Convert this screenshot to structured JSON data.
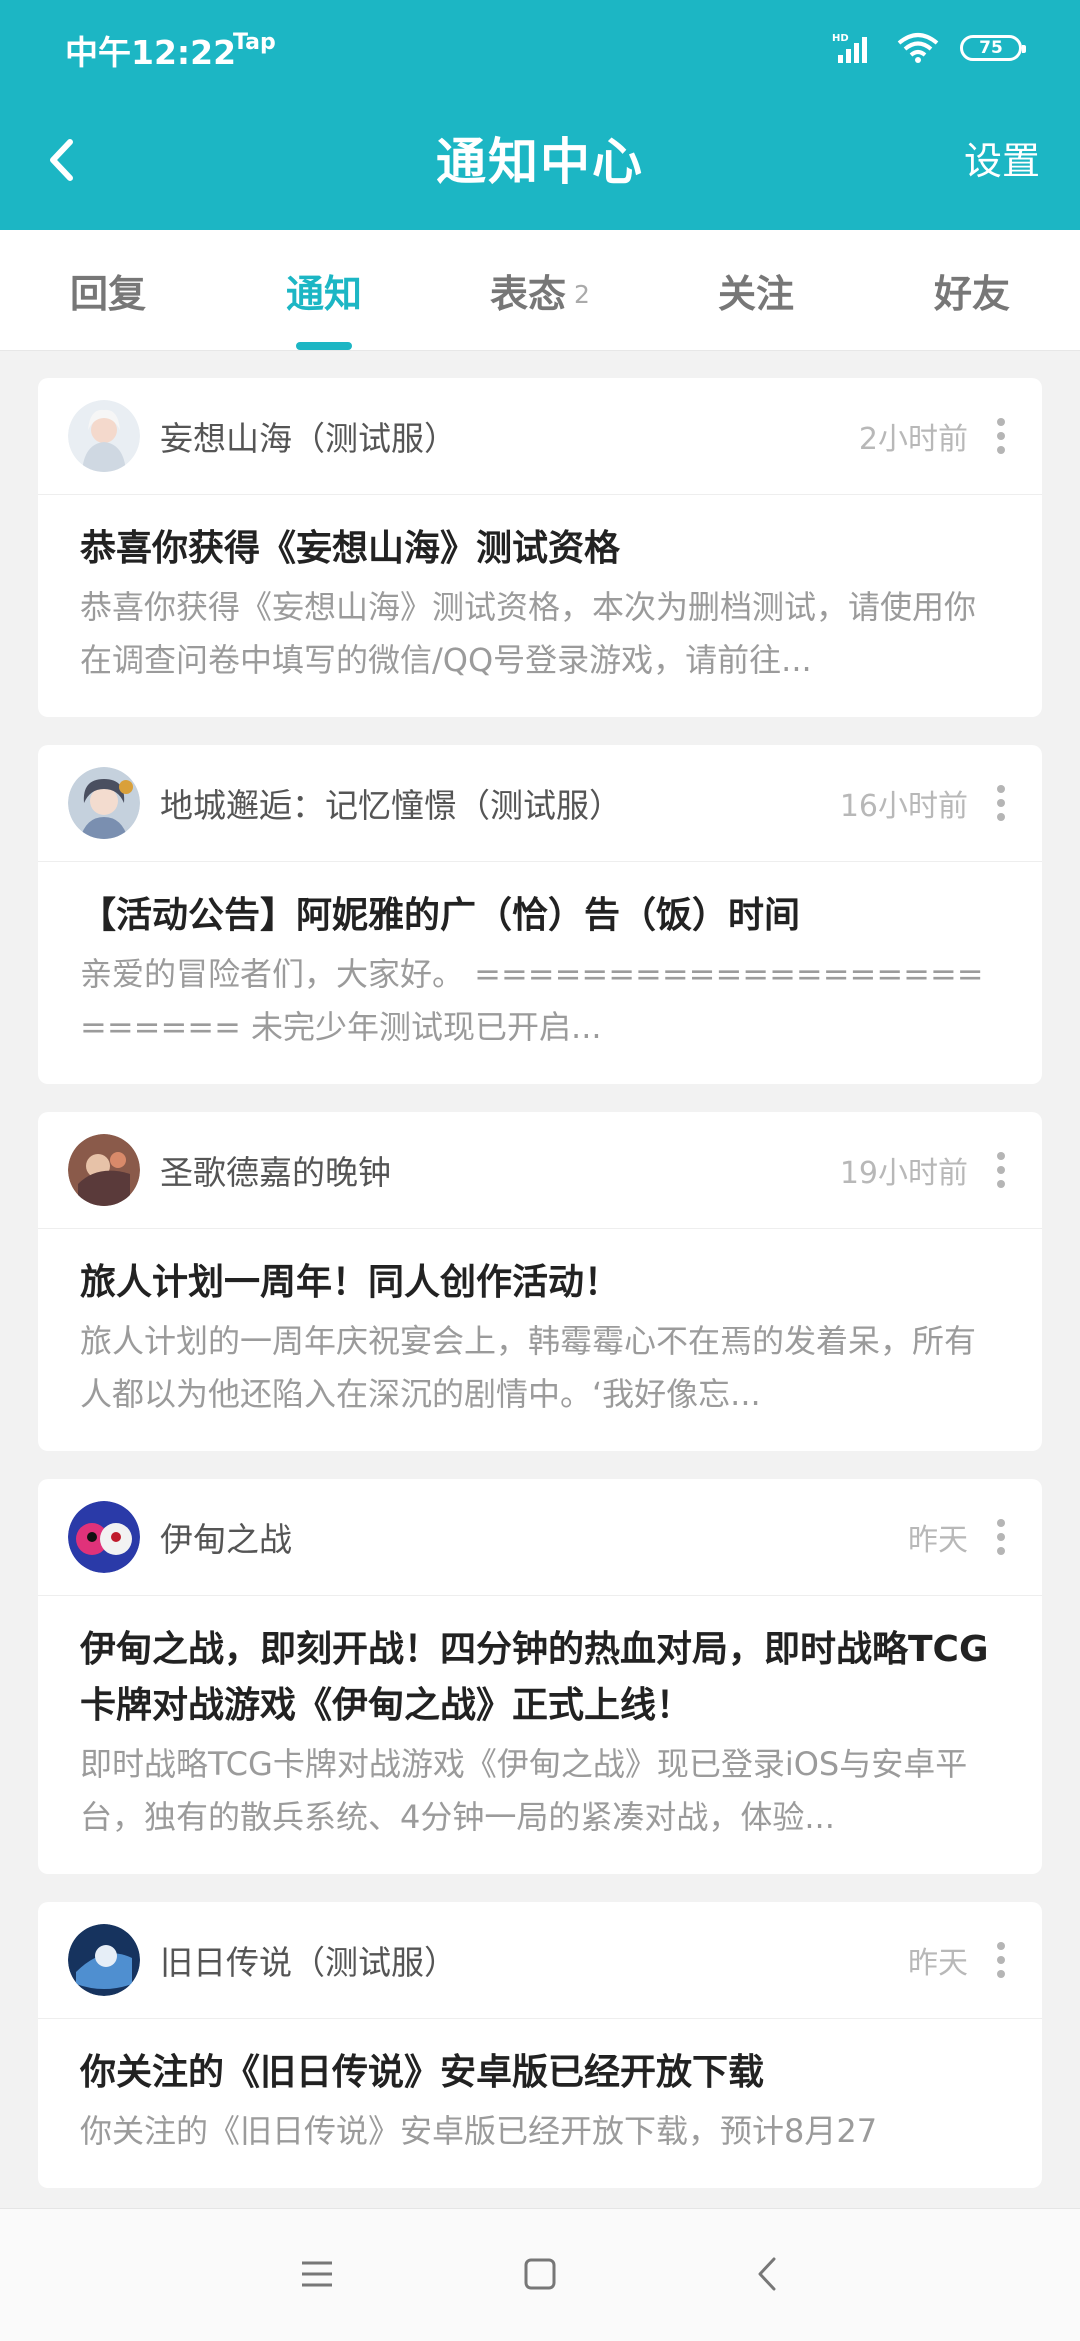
{
  "status": {
    "time": "中午12:22",
    "carrier": "Tap",
    "battery": "75",
    "icons": [
      "hd-signal-icon",
      "wifi-icon",
      "battery-icon"
    ]
  },
  "header": {
    "title": "通知中心",
    "settings_label": "设置",
    "back_icon": "back-chevron-icon"
  },
  "tabs": [
    {
      "label": "回复",
      "badge": "",
      "active": false
    },
    {
      "label": "通知",
      "badge": "",
      "active": true
    },
    {
      "label": "表态",
      "badge": "2",
      "active": false
    },
    {
      "label": "关注",
      "badge": "",
      "active": false
    },
    {
      "label": "好友",
      "badge": "",
      "active": false
    }
  ],
  "notifications": [
    {
      "game": "妄想山海（测试服）",
      "time": "2小时前",
      "title": "恭喜你获得《妄想山海》测试资格",
      "desc": "恭喜你获得《妄想山海》测试资格，本次为删档测试，请使用你在调查问卷中填写的微信/QQ号登录游戏，请前往..."
    },
    {
      "game": "地城邂逅：记忆憧憬（测试服）",
      "time": "16小时前",
      "title": "【活动公告】阿妮雅的广（恰）告（饭）时间",
      "desc": "亲爱的冒险者们，大家好。 ========================= 未完少年测试现已开启..."
    },
    {
      "game": "圣歌德嘉的晚钟",
      "time": "19小时前",
      "title": "旅人计划一周年！同人创作活动！",
      "desc": "旅人计划的一周年庆祝宴会上，韩霉霉心不在焉的发着呆，所有人都以为他还陷入在深沉的剧情中。‘我好像忘..."
    },
    {
      "game": "伊甸之战",
      "time": "昨天",
      "title": "伊甸之战，即刻开战！四分钟的热血对局，即时战略TCG卡牌对战游戏《伊甸之战》正式上线！",
      "desc": "即时战略TCG卡牌对战游戏《伊甸之战》现已登录iOS与安卓平台，独有的散兵系统、4分钟一局的紧凑对战，体验..."
    },
    {
      "game": "旧日传说（测试服）",
      "time": "昨天",
      "title": "你关注的《旧日传说》安卓版已经开放下载",
      "desc": "你关注的《旧日传说》安卓版已经开放下载，预计8月27"
    }
  ],
  "colors": {
    "accent": "#1cb6c4",
    "avatars": [
      "#dfe6ee",
      "#b9c7d6",
      "#9a6a5a",
      "#c23a7a",
      "#1f4f8a"
    ]
  }
}
